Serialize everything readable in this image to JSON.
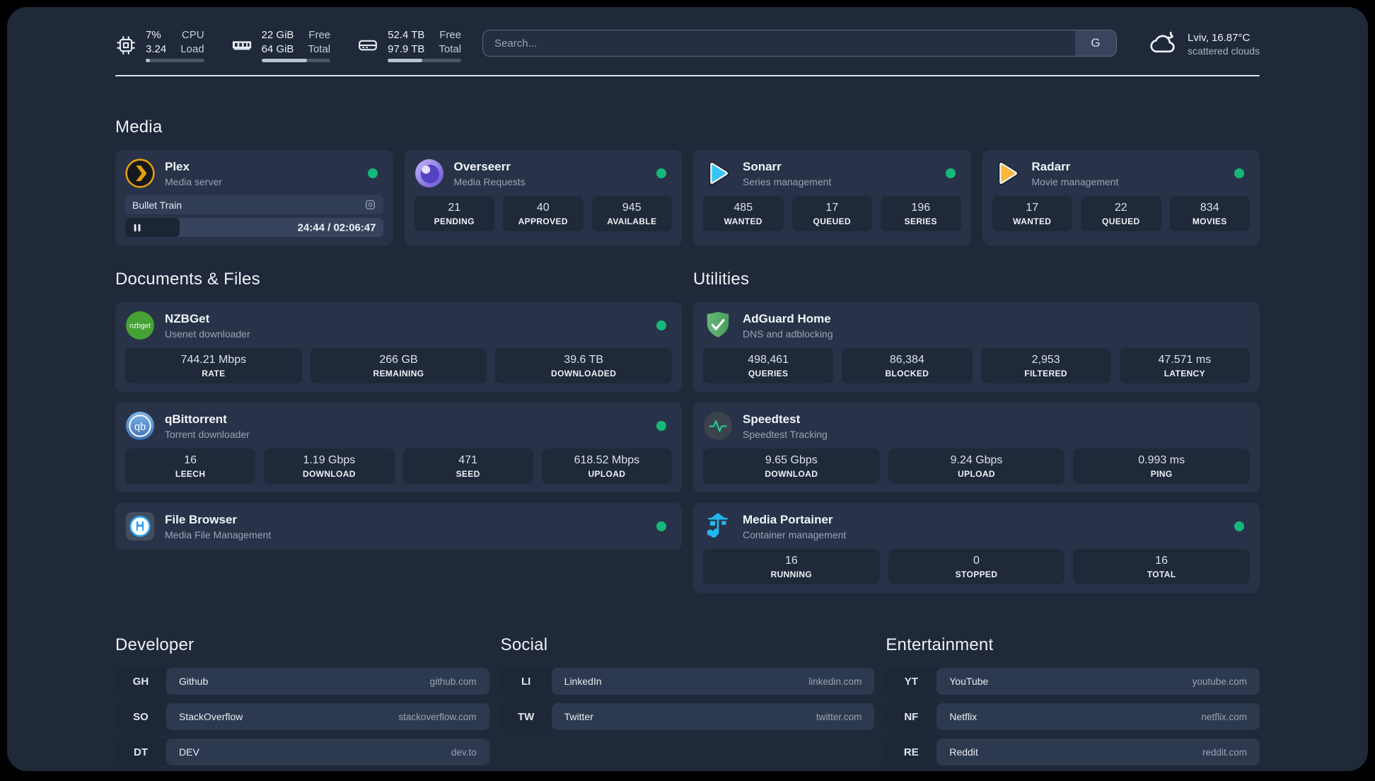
{
  "topbar": {
    "resources": [
      {
        "icon": "cpu-icon",
        "values": [
          "7%",
          "3.24"
        ],
        "labels": [
          "CPU",
          "Load"
        ],
        "progress_percent": 7
      },
      {
        "icon": "memory-icon",
        "values": [
          "22 GiB",
          "64 GiB"
        ],
        "labels": [
          "Free",
          "Total"
        ],
        "progress_percent": 66
      },
      {
        "icon": "disk-icon",
        "values": [
          "52.4 TB",
          "97.9 TB"
        ],
        "labels": [
          "Free",
          "Total"
        ],
        "progress_percent": 47
      }
    ],
    "search": {
      "placeholder": "Search...",
      "provider_button": "G"
    },
    "weather": {
      "location": "Lviv, 16.87°C",
      "condition": "scattered clouds"
    }
  },
  "groups": {
    "media": {
      "title": "Media",
      "services": [
        {
          "name": "Plex",
          "subtitle": "Media server",
          "status": "online",
          "player": {
            "track": "Bullet Train",
            "time_display": "24:44 / 02:06:47",
            "progress_percent": 21,
            "state": "paused"
          }
        },
        {
          "name": "Overseerr",
          "subtitle": "Media Requests",
          "status": "online",
          "stats": [
            {
              "value": "21",
              "label": "PENDING"
            },
            {
              "value": "40",
              "label": "APPROVED"
            },
            {
              "value": "945",
              "label": "AVAILABLE"
            }
          ]
        },
        {
          "name": "Sonarr",
          "subtitle": "Series management",
          "status": "online",
          "stats": [
            {
              "value": "485",
              "label": "WANTED"
            },
            {
              "value": "17",
              "label": "QUEUED"
            },
            {
              "value": "196",
              "label": "SERIES"
            }
          ]
        },
        {
          "name": "Radarr",
          "subtitle": "Movie management",
          "status": "online",
          "stats": [
            {
              "value": "17",
              "label": "WANTED"
            },
            {
              "value": "22",
              "label": "QUEUED"
            },
            {
              "value": "834",
              "label": "MOVIES"
            }
          ]
        }
      ]
    },
    "documents": {
      "title": "Documents & Files",
      "services": [
        {
          "name": "NZBGet",
          "subtitle": "Usenet downloader",
          "status": "online",
          "stats": [
            {
              "value": "744.21 Mbps",
              "label": "RATE"
            },
            {
              "value": "266 GB",
              "label": "REMAINING"
            },
            {
              "value": "39.6 TB",
              "label": "DOWNLOADED"
            }
          ]
        },
        {
          "name": "qBittorrent",
          "subtitle": "Torrent downloader",
          "status": "online",
          "stats": [
            {
              "value": "16",
              "label": "LEECH"
            },
            {
              "value": "1.19 Gbps",
              "label": "DOWNLOAD"
            },
            {
              "value": "471",
              "label": "SEED"
            },
            {
              "value": "618.52 Mbps",
              "label": "UPLOAD"
            }
          ]
        },
        {
          "name": "File Browser",
          "subtitle": "Media File Management",
          "status": "online"
        }
      ]
    },
    "utilities": {
      "title": "Utilities",
      "services": [
        {
          "name": "AdGuard Home",
          "subtitle": "DNS and adblocking",
          "stats": [
            {
              "value": "498,461",
              "label": "QUERIES"
            },
            {
              "value": "86,384",
              "label": "BLOCKED"
            },
            {
              "value": "2,953",
              "label": "FILTERED"
            },
            {
              "value": "47.571 ms",
              "label": "LATENCY"
            }
          ]
        },
        {
          "name": "Speedtest",
          "subtitle": "Speedtest Tracking",
          "stats": [
            {
              "value": "9.65 Gbps",
              "label": "DOWNLOAD"
            },
            {
              "value": "9.24 Gbps",
              "label": "UPLOAD"
            },
            {
              "value": "0.993 ms",
              "label": "PING"
            }
          ]
        },
        {
          "name": "Media Portainer",
          "subtitle": "Container management",
          "status": "online",
          "stats": [
            {
              "value": "16",
              "label": "RUNNING"
            },
            {
              "value": "0",
              "label": "STOPPED"
            },
            {
              "value": "16",
              "label": "TOTAL"
            }
          ]
        }
      ]
    }
  },
  "bookmarks": [
    {
      "title": "Developer",
      "links": [
        {
          "abbr": "GH",
          "name": "Github",
          "url": "github.com"
        },
        {
          "abbr": "SO",
          "name": "StackOverflow",
          "url": "stackoverflow.com"
        },
        {
          "abbr": "DT",
          "name": "DEV",
          "url": "dev.to"
        }
      ]
    },
    {
      "title": "Social",
      "links": [
        {
          "abbr": "LI",
          "name": "LinkedIn",
          "url": "linkedin.com"
        },
        {
          "abbr": "TW",
          "name": "Twitter",
          "url": "twitter.com"
        }
      ]
    },
    {
      "title": "Entertainment",
      "links": [
        {
          "abbr": "YT",
          "name": "YouTube",
          "url": "youtube.com"
        },
        {
          "abbr": "NF",
          "name": "Netflix",
          "url": "netflix.com"
        },
        {
          "abbr": "RE",
          "name": "Reddit",
          "url": "reddit.com"
        }
      ]
    }
  ],
  "colors": {
    "status_online": "#16b87a",
    "plex_accent": "#e5a00d",
    "sonarr_accent": "#35c5f4",
    "radarr_accent": "#ffb53a",
    "portainer_accent": "#23b8f0"
  }
}
